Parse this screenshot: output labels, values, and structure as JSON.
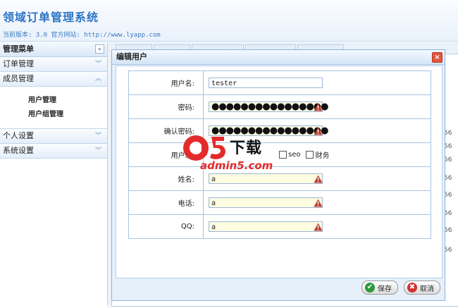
{
  "header": {
    "title": "领域订单管理系统",
    "version": "当前版本: 3.0 官方网站: http://www.lyapp.com"
  },
  "sidebar": {
    "title": "管理菜单",
    "collapse": "«",
    "groups": [
      {
        "label": "订单管理"
      },
      {
        "label": "成员管理",
        "items": [
          "用户管理",
          "用户组管理"
        ]
      },
      {
        "label": "个人设置"
      },
      {
        "label": "系统设置"
      }
    ]
  },
  "background": {
    "row_values": [
      "56",
      "56",
      "56",
      "56",
      "56",
      "56",
      "56",
      "56"
    ]
  },
  "dialog": {
    "title": "编辑用户",
    "close": "×",
    "fields": {
      "username_label": "用户名:",
      "username_value": "tester",
      "password_label": "密码:",
      "password_value": "●●●●●●●●●●●●●●●●",
      "confirm_label": "确认密码:",
      "confirm_value": "●●●●●●●●●●●●●●●●",
      "group_label": "用户组:",
      "group_options": [
        "seo",
        "财务"
      ],
      "name_label": "姓名:",
      "name_value": "a",
      "phone_label": "电话:",
      "phone_value": "a",
      "qq_label": "QQ:",
      "qq_value": "a"
    },
    "save_label": "保存",
    "cancel_label": "取消"
  },
  "watermark": {
    "brand": "a5",
    "download": "下载",
    "site": "admin5.com"
  },
  "colors": {
    "accent": "#2d74c4",
    "warning": "#c0392b",
    "ok": "#2e9a3e",
    "cancel": "#d0312d"
  }
}
